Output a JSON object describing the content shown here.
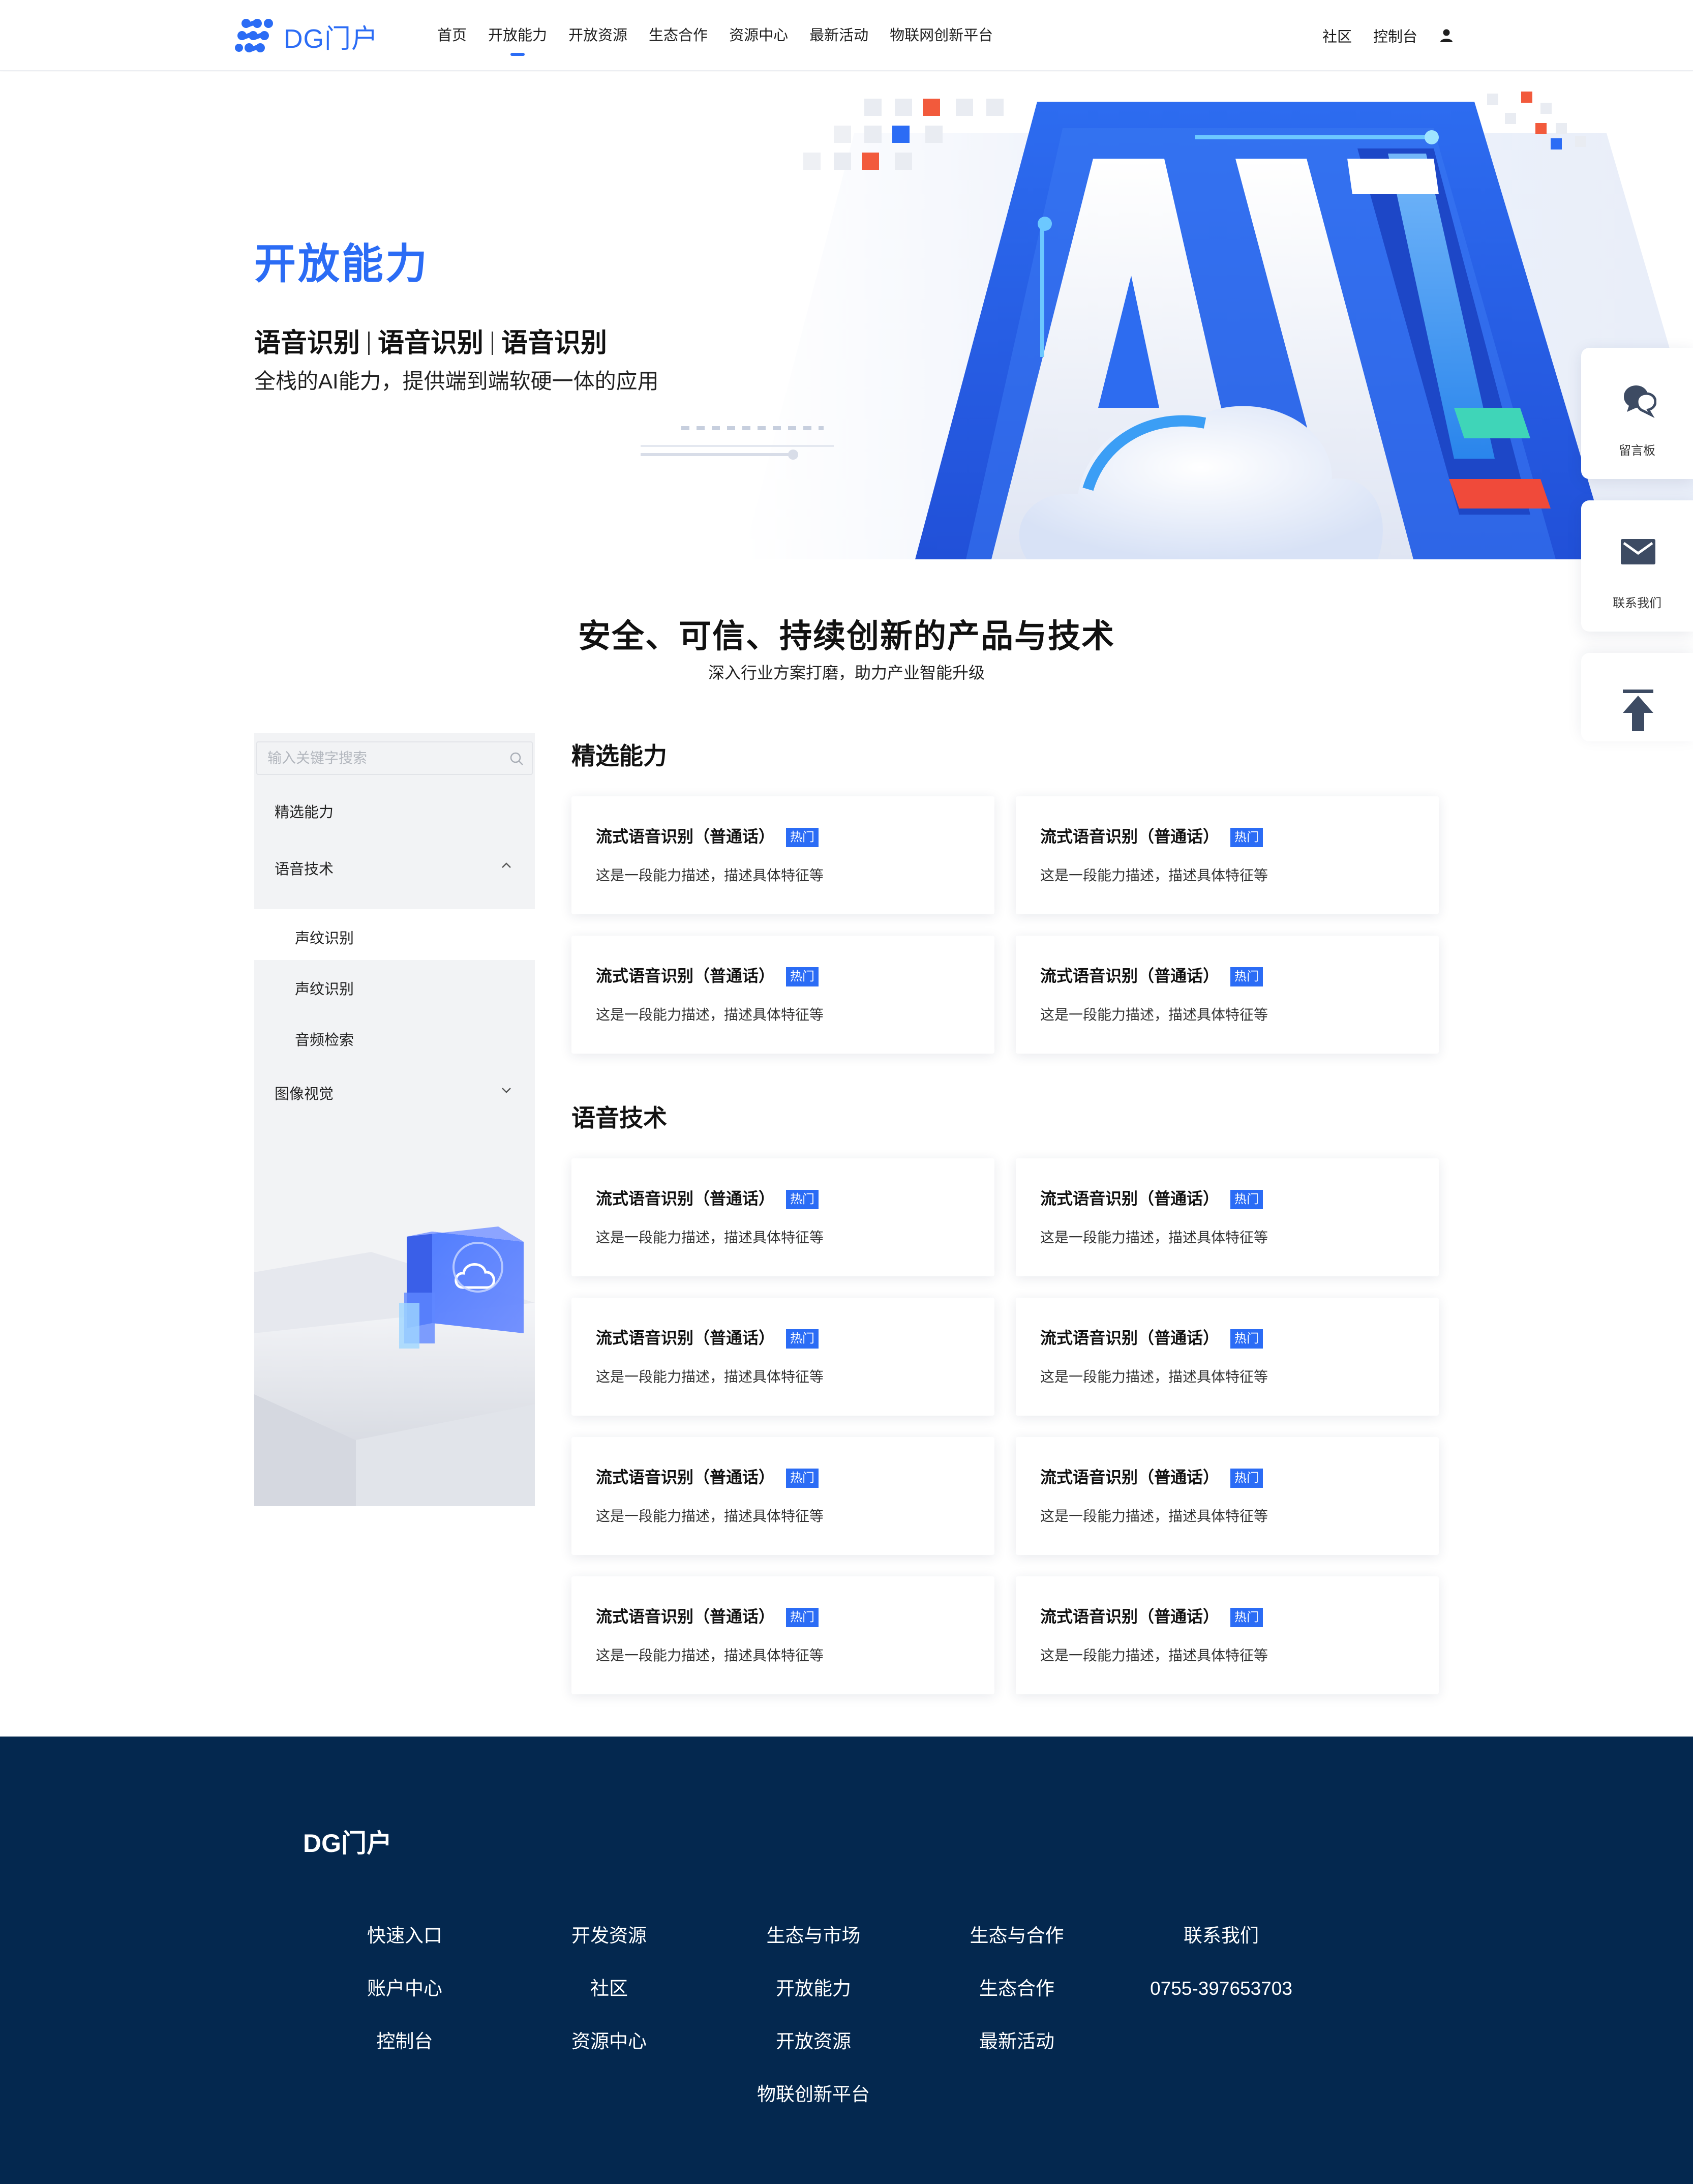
{
  "header": {
    "logo_text": "DG门户",
    "nav": [
      {
        "label": "首页",
        "active": false
      },
      {
        "label": "开放能力",
        "active": true
      },
      {
        "label": "开放资源",
        "active": false
      },
      {
        "label": "生态合作",
        "active": false
      },
      {
        "label": "资源中心",
        "active": false
      },
      {
        "label": "最新活动",
        "active": false
      },
      {
        "label": "物联网创新平台",
        "active": false
      }
    ],
    "right_links": [
      "社区",
      "控制台"
    ],
    "user_icon": "user-icon",
    "accent": "#2b6cf5"
  },
  "hero": {
    "title": "开放能力",
    "tags": [
      "语音识别",
      "语音识别",
      "语音识别"
    ],
    "desc": "全栈的AI能力，提供端到端软硬一体的应用"
  },
  "section": {
    "title": "安全、可信、持续创新的产品与技术",
    "subtitle": "深入行业方案打磨，助力产业智能升级"
  },
  "sidebar": {
    "search_placeholder": "输入关键字搜索",
    "items": [
      {
        "label": "精选能力",
        "level": 1
      },
      {
        "label": "语音技术",
        "level": 1,
        "expanded": true
      },
      {
        "label": "声纹识别",
        "level": 2,
        "selected": true
      },
      {
        "label": "声纹识别",
        "level": 2
      },
      {
        "label": "音频检索",
        "level": 2
      },
      {
        "label": "图像视觉",
        "level": 1,
        "expanded": false
      }
    ]
  },
  "groups": [
    {
      "title": "精选能力",
      "cards": [
        {
          "title": "流式语音识别（普通话）",
          "badge": "热门",
          "desc": "这是一段能力描述，描述具体特征等"
        },
        {
          "title": "流式语音识别（普通话）",
          "badge": "热门",
          "desc": "这是一段能力描述，描述具体特征等"
        },
        {
          "title": "流式语音识别（普通话）",
          "badge": "热门",
          "desc": "这是一段能力描述，描述具体特征等"
        },
        {
          "title": "流式语音识别（普通话）",
          "badge": "热门",
          "desc": "这是一段能力描述，描述具体特征等"
        }
      ]
    },
    {
      "title": "语音技术",
      "cards": [
        {
          "title": "流式语音识别（普通话）",
          "badge": "热门",
          "desc": "这是一段能力描述，描述具体特征等"
        },
        {
          "title": "流式语音识别（普通话）",
          "badge": "热门",
          "desc": "这是一段能力描述，描述具体特征等"
        },
        {
          "title": "流式语音识别（普通话）",
          "badge": "热门",
          "desc": "这是一段能力描述，描述具体特征等"
        },
        {
          "title": "流式语音识别（普通话）",
          "badge": "热门",
          "desc": "这是一段能力描述，描述具体特征等"
        },
        {
          "title": "流式语音识别（普通话）",
          "badge": "热门",
          "desc": "这是一段能力描述，描述具体特征等"
        },
        {
          "title": "流式语音识别（普通话）",
          "badge": "热门",
          "desc": "这是一段能力描述，描述具体特征等"
        },
        {
          "title": "流式语音识别（普通话）",
          "badge": "热门",
          "desc": "这是一段能力描述，描述具体特征等"
        },
        {
          "title": "流式语音识别（普通话）",
          "badge": "热门",
          "desc": "这是一段能力描述，描述具体特征等"
        }
      ]
    }
  ],
  "float_bar": [
    {
      "label": "留言板",
      "icon": "message-board-icon"
    },
    {
      "label": "联系我们",
      "icon": "mail-icon"
    },
    {
      "label": "",
      "icon": "back-to-top-icon"
    }
  ],
  "footer": {
    "brand": "DG门户",
    "columns": [
      {
        "items": [
          "快速入口",
          "账户中心",
          "控制台"
        ]
      },
      {
        "items": [
          "开发资源",
          "社区",
          "资源中心"
        ]
      },
      {
        "items": [
          "生态与市场",
          "开放能力",
          "开放资源",
          "物联创新平台"
        ]
      },
      {
        "items": [
          "生态与合作",
          "生态合作",
          "最新活动"
        ]
      },
      {
        "items": [
          "联系我们",
          "0755-397653703"
        ]
      }
    ],
    "background": "#04284f"
  }
}
